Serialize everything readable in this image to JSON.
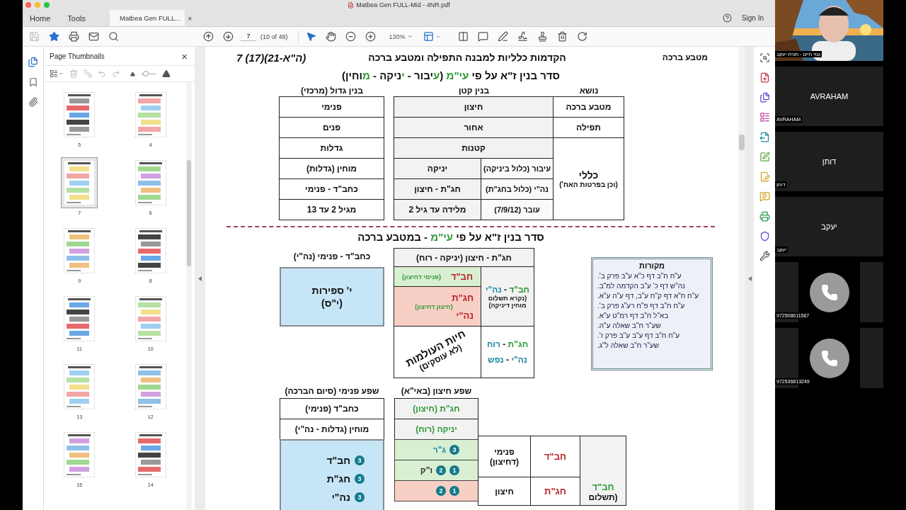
{
  "titlebar": {
    "title": "Matbea Gen FULL-Mid - 4NR.pdf"
  },
  "home_tab": {
    "label": "Home",
    "selected": false
  },
  "tools_tab": {
    "label": "Tools",
    "selected": false
  },
  "document_tab": {
    "label": "Matbea Gen FULL...",
    "selected": true,
    "close": "×"
  },
  "sign_in": "Sign In",
  "toolbar": {
    "page": "7",
    "page_count": "(10 of 48)",
    "zoom": "130%"
  },
  "side_rail": [
    {
      "kind": "pages",
      "selected": true
    },
    {
      "kind": "bookmarks",
      "selected": false
    },
    {
      "kind": "attachments",
      "selected": false
    }
  ],
  "thumbnails": {
    "title": "Page Thumbnails",
    "close": "×",
    "size": {
      "level": 0.3
    },
    "pages": [
      {
        "label": "4",
        "selected": false
      },
      {
        "label": "5",
        "selected": false
      },
      {
        "label": "6",
        "selected": false
      },
      {
        "label": "7",
        "selected": true
      },
      {
        "label": "8",
        "selected": false
      },
      {
        "label": "9",
        "selected": false
      },
      {
        "label": "10",
        "selected": false
      },
      {
        "label": "11",
        "selected": false
      },
      {
        "label": "12",
        "selected": false
      },
      {
        "label": "13",
        "selected": false
      },
      {
        "label": "14",
        "selected": false
      },
      {
        "label": "15",
        "selected": false
      }
    ]
  },
  "document": {
    "header": {
      "section": "מטבע ברכה",
      "title": "הקדמות כלליות למבנה התפילה ומטבע ברכה",
      "page_ref": "7 (17)(21-ה\"א)"
    },
    "heading_1": [
      {
        "text": "סדר בנין ז\"א על פי "
      },
      {
        "text": "עי\"מ",
        "color": "#2e9a3a"
      },
      {
        "text": " ("
      },
      {
        "text": "ע",
        "color": "#2e9a3a"
      },
      {
        "text": "יבור - "
      },
      {
        "text": "י",
        "color": "#2e9a3a"
      },
      {
        "text": "ניקה - "
      },
      {
        "text": "מ",
        "color": "#2e9a3a"
      },
      {
        "text": "וחין)"
      }
    ],
    "table_1": {
      "headers": {
        "topic": "נושא",
        "small": "בנין קטן",
        "large": "בנין גדול (מרכזי)"
      },
      "general": {
        "title": "כללי",
        "note": "(וכן בפרטות האח')"
      },
      "rows": [
        {
          "topic": "מטבע ברכה",
          "small": [
            "חיצון"
          ],
          "large": "פנימי"
        },
        {
          "topic": "תפילה",
          "small": [
            "אחור"
          ],
          "large": "פנים"
        },
        {
          "small": [
            "קטנות"
          ],
          "large": "גדלות"
        },
        {
          "small": [
            "עיבור (כלול ביניקה)",
            "יניקה"
          ],
          "large": "מוחין (גדלות)"
        },
        {
          "small": [
            "נה\"י (כלול בחג\"ת)",
            "חג\"ת - חיצון"
          ],
          "large": "כחב\"ד - פנימי"
        },
        {
          "small": [
            "עובר (7/9/12)",
            "מלידה עד גיל 2"
          ],
          "large": "מגיל 2 עד 13"
        }
      ]
    },
    "heading_2": [
      {
        "text": "סדר בנין ז\"א על פי "
      },
      {
        "text": "עי\"מ",
        "color": "#2e9a3a"
      },
      {
        "text": " - במטבע ברכה"
      }
    ],
    "inner_block": {
      "header": "כחב\"ד - פנימי (נה\"י)",
      "lines": [
        "י' ספירות",
        "(י\"ס)"
      ]
    },
    "outer_table": {
      "header": "חג\"ת - חיצון (יניקה - רוח)",
      "inner_outer": {
        "label": "חב\"ד",
        "note": "(פנימי דחיצון)"
      },
      "outer_outer": {
        "labels": [
          "חג\"ת",
          "נה\"י"
        ],
        "note": "(חיצון דחיצון)"
      },
      "vitality": {
        "text": "חיות העולמות",
        "note": "(לא עוסקים)"
      },
      "payment": {
        "title": [
          {
            "text": "חב\"ד",
            "color": "#2e9a3a"
          },
          {
            "text": " - "
          },
          {
            "text": "נה\"י",
            "color": "#1f8aa8"
          }
        ],
        "note": [
          "(נקרא תשלום",
          "מוחין דיניקה)"
        ]
      },
      "spirit": [
        [
          {
            "text": "חג\"ת",
            "color": "#2e9a3a"
          },
          {
            "text": " - "
          },
          {
            "text": "רוח",
            "color": "#1f8aa8"
          }
        ],
        [
          {
            "text": "נה\"י",
            "color": "#1f8aa8"
          },
          {
            "text": " - "
          },
          {
            "text": "נפש",
            "color": "#1f8aa8"
          }
        ]
      ]
    },
    "sources": {
      "title": "מקורות",
      "lines": [
        "ע\"ח ח\"ב דף כ\"א ע\"ב פרק ב'.",
        "נה\"ש דף כ' ע\"ב הקדמה למ\"ב.",
        "ע\"ח ח\"א דף ק\"ח ע\"ב, דף ע\"ה ע\"א.",
        "ע\"ח ח\"ב דף פ\"ח רע\"ג פרק ב'.",
        "בא\"ל ח\"ב דף רמ\"ט ע\"א.",
        "שע\"ר ח\"ב שאלה ע\"ה.",
        "ע\"ח ח\"ב דף ע\"ב ע\"ב פרק ז'.",
        "שע\"ר ח\"ב שאלה ל\"ג."
      ]
    },
    "inner_flow": {
      "header": "שפע פנימי (סיום הברכה)",
      "rows": [
        "כחב\"ד (פנימי)",
        "מוחין (גדלות - נה\"י)"
      ],
      "items": [
        {
          "badges": [
            "3"
          ],
          "label": "חב\"ד"
        },
        {
          "badges": [
            "3"
          ],
          "label": "חג\"ת"
        },
        {
          "badges": [
            "3"
          ],
          "label": "נה\"י"
        }
      ]
    },
    "outer_flow": {
      "header": "שפע חיצון (באי\"א)",
      "rows": [
        "חג\"ת (חיצון)",
        "יניקה (רוח)"
      ],
      "cells": [
        {
          "kind": "green",
          "badges": [
            "3"
          ],
          "label": "ג\"ר"
        },
        {
          "kind": "green",
          "badges": [
            "1",
            "2"
          ],
          "label": "ו\"ק"
        },
        {
          "kind": "red",
          "badges": [
            "1",
            "2"
          ]
        }
      ]
    },
    "outer_grid": {
      "rows": [
        {
          "side": [
            "פנימי",
            "(דחיצון)"
          ],
          "part": "חב\"ד"
        },
        {
          "side": [
            "חיצון"
          ],
          "part": "חג\"ת"
        }
      ],
      "total": {
        "title": "חב\"ד",
        "note": "(תשלום"
      }
    }
  },
  "video": {
    "host": {
      "name": "גנזי חיים - תורת יעקב"
    },
    "participants": [
      {
        "kind": "name",
        "display": "AVRAHAM",
        "label": "AVRAHAM"
      },
      {
        "kind": "name",
        "display": "דותן",
        "label": "דותן"
      },
      {
        "kind": "name",
        "display": "יעקב",
        "label": "יעקב"
      },
      {
        "kind": "phone",
        "label": "972508611567"
      },
      {
        "kind": "phone",
        "label": "972536813249"
      }
    ]
  }
}
